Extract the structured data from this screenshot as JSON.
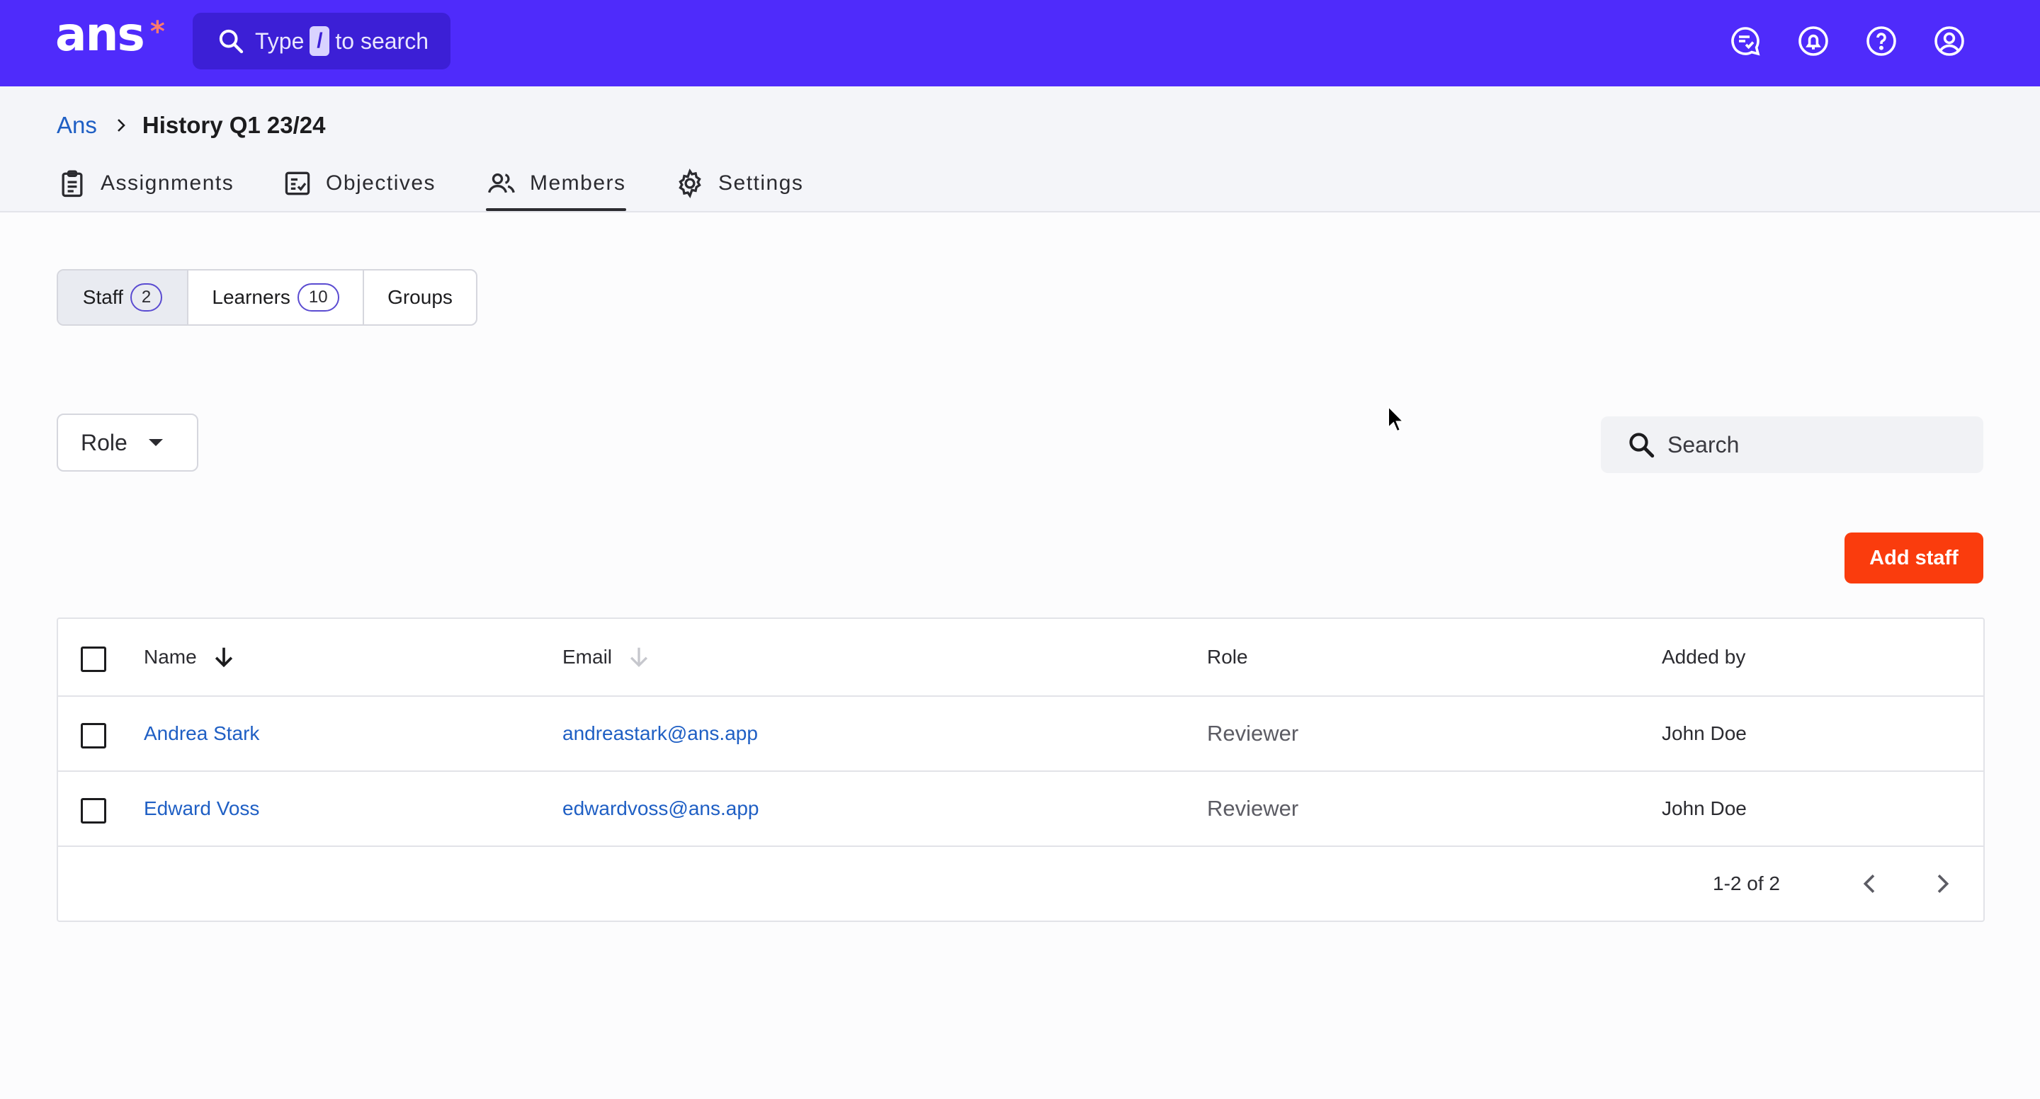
{
  "app": {
    "logo_text": "ans",
    "logo_mark": "*",
    "brand_color": "#4f2bfb",
    "accent_color": "#fa3c0d"
  },
  "topbar": {
    "search": {
      "prefix": "Type",
      "key": "/",
      "suffix": "to search",
      "icon": "search-icon"
    },
    "icons": [
      "chat-check-icon",
      "notification-bell-icon",
      "help-icon",
      "account-icon"
    ]
  },
  "breadcrumb": {
    "root": "Ans",
    "current": "History Q1 23/24"
  },
  "tabs": [
    {
      "label": "Assignments",
      "icon": "clipboard-icon"
    },
    {
      "label": "Objectives",
      "icon": "checklist-icon"
    },
    {
      "label": "Members",
      "icon": "people-icon",
      "active": true
    },
    {
      "label": "Settings",
      "icon": "gear-icon"
    }
  ],
  "segments": [
    {
      "label": "Staff",
      "count": "2",
      "active": true
    },
    {
      "label": "Learners",
      "count": "10"
    },
    {
      "label": "Groups"
    }
  ],
  "filters": {
    "role_label": "Role",
    "search_placeholder": "Search"
  },
  "actions": {
    "add_staff": "Add staff"
  },
  "table": {
    "columns": [
      "Name",
      "Email",
      "Role",
      "Added by"
    ],
    "rows": [
      {
        "name": "Andrea Stark",
        "email": "andreastark@ans.app",
        "role": "Reviewer",
        "added_by": "John Doe"
      },
      {
        "name": "Edward Voss",
        "email": "edwardvoss@ans.app",
        "role": "Reviewer",
        "added_by": "John Doe"
      }
    ],
    "pagination": "1-2 of 2"
  }
}
